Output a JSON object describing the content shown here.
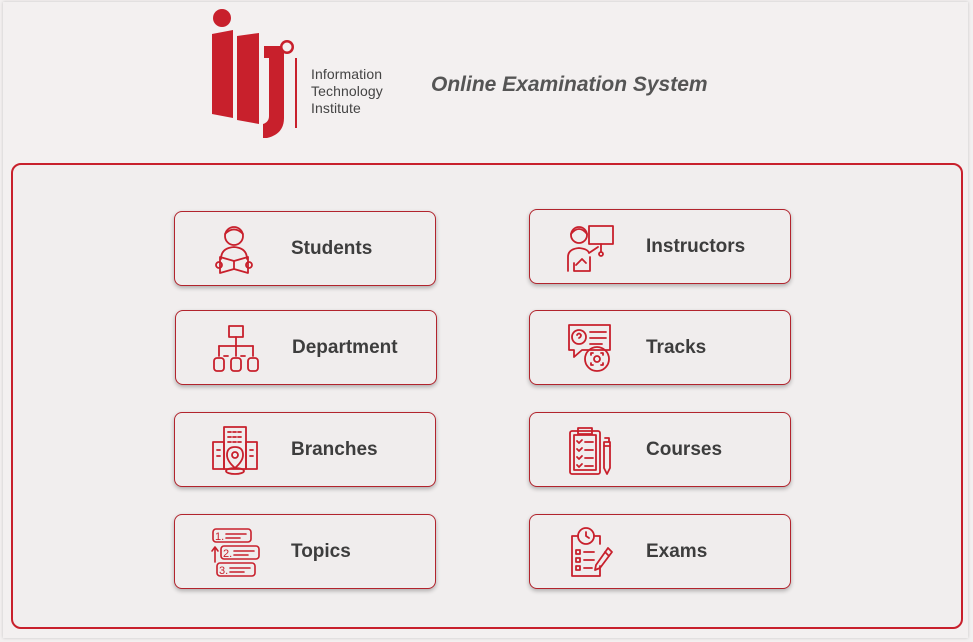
{
  "header": {
    "logo_lines": [
      "Information",
      "Technology",
      "Institute"
    ],
    "app_title": "Online Examination System"
  },
  "colors": {
    "accent": "#c8202c",
    "background": "#f3f0f0",
    "text": "#3d3d3d"
  },
  "menu": {
    "students": {
      "label": "Students",
      "icon": "student-reading-icon"
    },
    "instructors": {
      "label": "Instructors",
      "icon": "instructor-board-icon"
    },
    "department": {
      "label": "Department",
      "icon": "hierarchy-icon"
    },
    "tracks": {
      "label": "Tracks",
      "icon": "question-chat-icon"
    },
    "branches": {
      "label": "Branches",
      "icon": "building-location-icon"
    },
    "courses": {
      "label": "Courses",
      "icon": "clipboard-checklist-icon"
    },
    "topics": {
      "label": "Topics",
      "icon": "numbered-list-icon"
    },
    "exams": {
      "label": "Exams",
      "icon": "exam-clipboard-icon"
    }
  }
}
